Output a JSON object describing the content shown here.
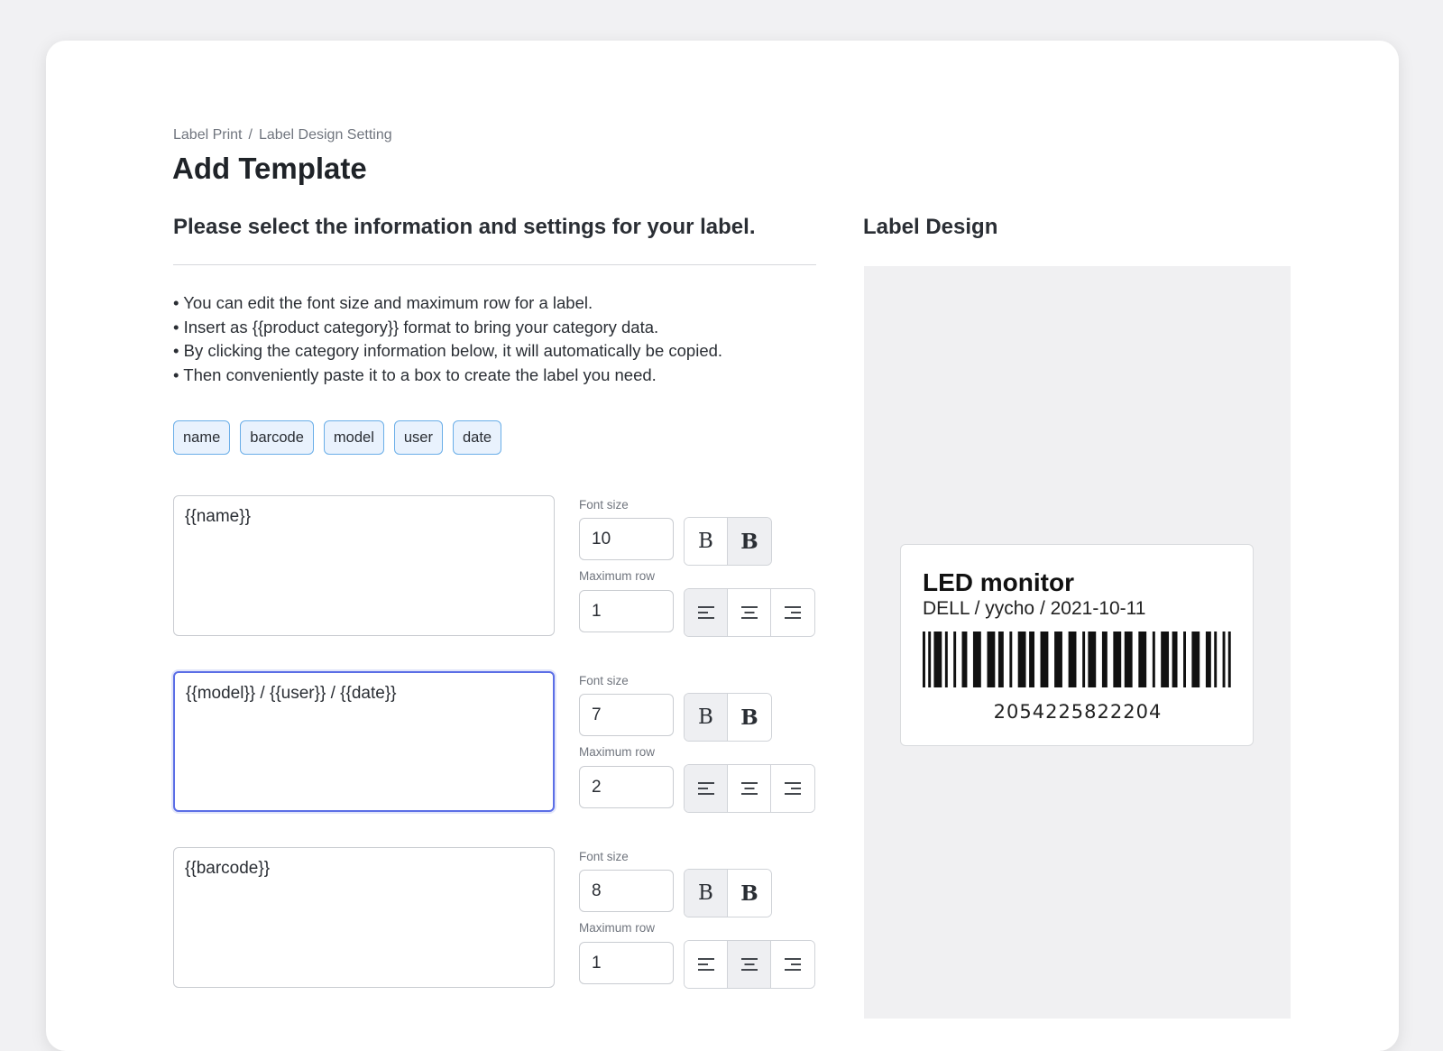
{
  "breadcrumb": {
    "parent": "Label Print",
    "separator": "/",
    "current": "Label Design Setting"
  },
  "page_title": "Add Template",
  "form": {
    "section_title": "Please select the information and settings for your label.",
    "instructions": [
      "• You can edit the font size and maximum row for a label.",
      "• Insert as {{product category}} format to bring your category data.",
      "• By clicking the category information below, it will automatically be copied.",
      "• Then conveniently paste it to a box to create the label you need."
    ],
    "tags": [
      "name",
      "barcode",
      "model",
      "user",
      "date"
    ],
    "font_size_label": "Font size",
    "max_row_label": "Maximum row",
    "bold_glyph": "B",
    "rows": [
      {
        "text": "{{name}}",
        "font_size": "10",
        "max_row": "1",
        "bold": true,
        "align": "left",
        "focused": false
      },
      {
        "text": "{{model}} / {{user}} / {{date}}",
        "font_size": "7",
        "max_row": "2",
        "bold": false,
        "align": "left",
        "focused": true
      },
      {
        "text": "{{barcode}}",
        "font_size": "8",
        "max_row": "1",
        "bold": false,
        "align": "center",
        "focused": false
      }
    ]
  },
  "preview": {
    "title": "Label Design",
    "label": {
      "name": "LED monitor",
      "meta": "DELL / yycho / 2021-10-11",
      "barcode_number": "2054225822204"
    }
  },
  "icons": {
    "align_left": "align-left-icon",
    "align_center": "align-center-icon",
    "align_right": "align-right-icon",
    "resize": "resize-grip-icon"
  },
  "colors": {
    "tag_bg": "#e9f2fd",
    "tag_border": "#6aaee8",
    "focus_border": "#5b6ee6",
    "active_segment": "#eeeff2",
    "preview_bg": "#f0f0f2"
  }
}
